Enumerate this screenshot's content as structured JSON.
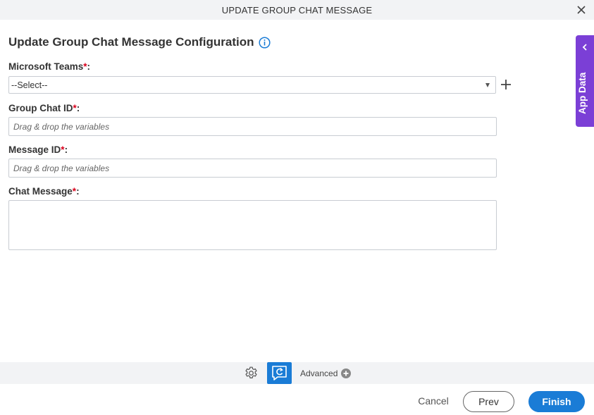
{
  "window": {
    "title": "UPDATE GROUP CHAT MESSAGE"
  },
  "form": {
    "heading": "Update Group Chat Message Configuration",
    "required_marker": "*",
    "label_suffix": ":",
    "microsoft_teams": {
      "label": "Microsoft Teams",
      "value": "--Select--"
    },
    "group_chat_id": {
      "label": "Group Chat ID",
      "placeholder": "Drag & drop the variables"
    },
    "message_id": {
      "label": "Message ID",
      "placeholder": "Drag & drop the variables"
    },
    "chat_message": {
      "label": "Chat Message"
    }
  },
  "side_panel": {
    "label": "App Data"
  },
  "toolbar": {
    "advanced_label": "Advanced"
  },
  "footer": {
    "cancel": "Cancel",
    "prev": "Prev",
    "finish": "Finish"
  },
  "colors": {
    "primary": "#1a7cd6",
    "app_data_tab": "#7b3fd6",
    "required": "#d9001b"
  },
  "icons": [
    "close-icon",
    "info-icon",
    "plus-icon",
    "chevron-left-icon",
    "gear-icon",
    "refresh-icon",
    "plus-circle-icon",
    "caret-down-icon"
  ]
}
